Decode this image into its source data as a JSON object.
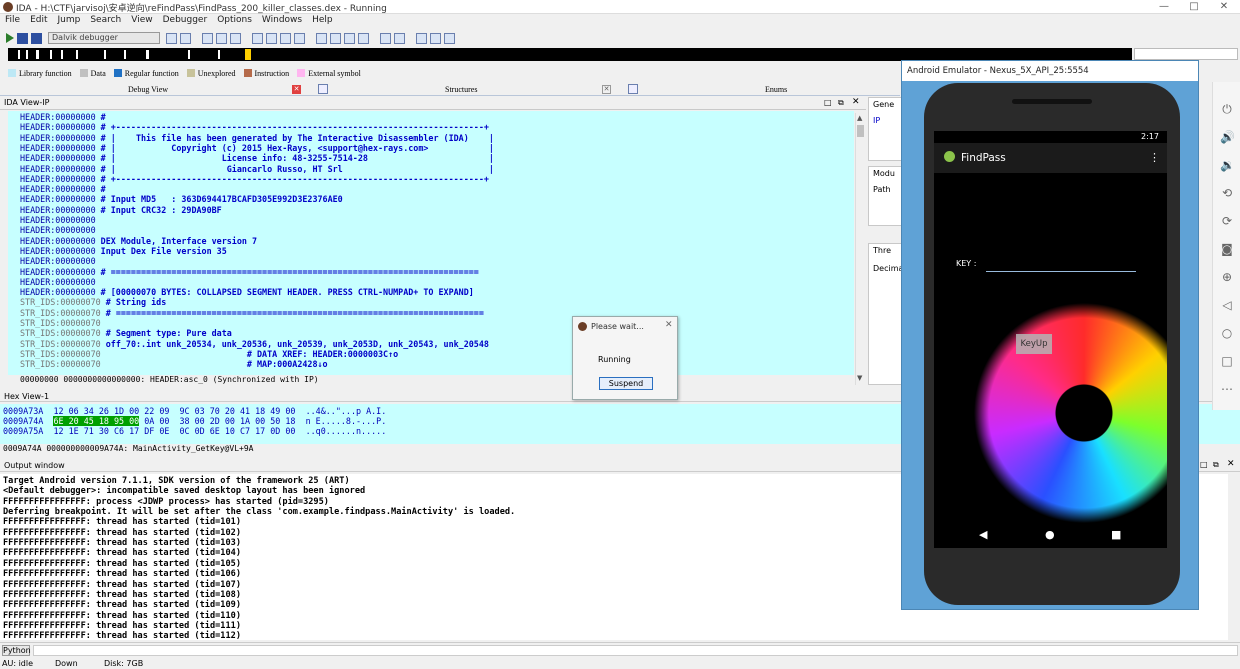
{
  "window": {
    "title": "IDA - H:\\CTF\\jarvisoj\\安卓逆向\\reFindPass\\FindPass_200_killer_classes.dex - Running",
    "controls": [
      "—",
      "□",
      "✕"
    ]
  },
  "menu": [
    "File",
    "Edit",
    "Jump",
    "Search",
    "View",
    "Debugger",
    "Options",
    "Windows",
    "Help"
  ],
  "toolbar": {
    "debugger_select": "Dalvik debugger"
  },
  "legend": [
    {
      "label": "Library function",
      "color": "#bde8f5"
    },
    {
      "label": "Data",
      "color": "#c0c0c0"
    },
    {
      "label": "Regular function",
      "color": "#2071c4"
    },
    {
      "label": "Unexplored",
      "color": "#c8c39b"
    },
    {
      "label": "Instruction",
      "color": "#b56a4a"
    },
    {
      "label": "External symbol",
      "color": "#ffb6f0"
    }
  ],
  "tabs": {
    "debug_view": "Debug View",
    "structures": "Structures",
    "enums": "Enums"
  },
  "ida_view": {
    "title": "IDA View-IP",
    "lines": [
      {
        "addr": "HEADER:00000000",
        "text": " #"
      },
      {
        "addr": "HEADER:00000000",
        "text": " # +-------------------------------------------------------------------------+"
      },
      {
        "addr": "HEADER:00000000",
        "text": " # |    This file has been generated by The Interactive Disassembler (IDA)    |"
      },
      {
        "addr": "HEADER:00000000",
        "text": " # |           Copyright (c) 2015 Hex-Rays, <support@hex-rays.com>            |"
      },
      {
        "addr": "HEADER:00000000",
        "text": " # |                     License info: 48-3255-7514-28                        |"
      },
      {
        "addr": "HEADER:00000000",
        "text": " # |                      Giancarlo Russo, HT Srl                             |"
      },
      {
        "addr": "HEADER:00000000",
        "text": " # +-------------------------------------------------------------------------+"
      },
      {
        "addr": "HEADER:00000000",
        "text": " #"
      },
      {
        "addr": "HEADER:00000000",
        "text": " # Input MD5   : 363D694417BCAFD305E992D3E2376AE0"
      },
      {
        "addr": "HEADER:00000000",
        "text": " # Input CRC32 : 29DA90BF"
      },
      {
        "addr": "HEADER:00000000",
        "text": ""
      },
      {
        "addr": "HEADER:00000000",
        "text": ""
      },
      {
        "addr": "HEADER:00000000",
        "text": " DEX Module, Interface version 7"
      },
      {
        "addr": "HEADER:00000000",
        "text": " Input Dex File version 35"
      },
      {
        "addr": "HEADER:00000000",
        "text": ""
      },
      {
        "addr": "HEADER:00000000",
        "text": " # ========================================================================="
      },
      {
        "addr": "HEADER:00000000",
        "text": ""
      },
      {
        "addr": "HEADER:00000000",
        "text": " # [00000070 BYTES: COLLAPSED SEGMENT HEADER. PRESS CTRL-NUMPAD+ TO EXPAND]"
      },
      {
        "addr": "STR_IDS:00000070",
        "text": " # String ids"
      },
      {
        "addr": "STR_IDS:00000070",
        "text": " # ========================================================================="
      },
      {
        "addr": "STR_IDS:00000070",
        "text": ""
      },
      {
        "addr": "STR_IDS:00000070",
        "text": " # Segment type: Pure data"
      },
      {
        "addr": "STR_IDS:00000070",
        "text": " off_70:.int unk_20534, unk_20536, unk_20539, unk_2053D, unk_20543, unk_20548"
      },
      {
        "addr": "STR_IDS:00000070",
        "text": "                             # DATA XREF: HEADER:0000003C↑o"
      },
      {
        "addr": "STR_IDS:00000070",
        "text": "                             # MAP:000A2428↓o"
      }
    ],
    "status": "00000000 0000000000000000: HEADER:asc_0 (Synchronized with IP)"
  },
  "hex_view": {
    "title": "Hex View-1",
    "rows": [
      {
        "addr": "0009A73A",
        "bytes": "12 06 34 26 1D 00 22 09  9C 03 70 20 41 18 49 00",
        "ascii": "..4&..\"...p A.I."
      },
      {
        "addr": "0009A74A",
        "bytes_sel": "6E 20 45 18 95 00",
        "bytes_rest": " 0A 00  38 00 2D 00 1A 00 50 18",
        "ascii": "n E.....8.-...P."
      },
      {
        "addr": "0009A75A",
        "bytes": "12 1E 71 30 C6 17 DF 0E  0C 0D 6E 10 C7 17 0D 00",
        "ascii": "..q0......n....."
      }
    ],
    "status": "0009A74A 000000000009A74A: MainActivity_GetKey@VL+9A"
  },
  "output": {
    "title": "Output window",
    "lines": [
      "Target Android version 7.1.1, SDK version of the framework 25 (ART)",
      "<Default debugger>: incompatible saved desktop layout has been ignored",
      "FFFFFFFFFFFFFFFF: process <JDWP process> has started (pid=3295)",
      "Deferring breakpoint. It will be set after the class 'com.example.findpass.MainActivity' is loaded.",
      "FFFFFFFFFFFFFFFF: thread has started (tid=101)",
      "FFFFFFFFFFFFFFFF: thread has started (tid=102)",
      "FFFFFFFFFFFFFFFF: thread has started (tid=103)",
      "FFFFFFFFFFFFFFFF: thread has started (tid=104)",
      "FFFFFFFFFFFFFFFF: thread has started (tid=105)",
      "FFFFFFFFFFFFFFFF: thread has started (tid=106)",
      "FFFFFFFFFFFFFFFF: thread has started (tid=107)",
      "FFFFFFFFFFFFFFFF: thread has started (tid=108)",
      "FFFFFFFFFFFFFFFF: thread has started (tid=109)",
      "FFFFFFFFFFFFFFFF: thread has started (tid=110)",
      "FFFFFFFFFFFFFFFF: thread has started (tid=111)",
      "FFFFFFFFFFFFFFFF: thread has started (tid=112)"
    ]
  },
  "python_btn": "Python",
  "statusbar": {
    "au": "AU:  idle",
    "dir": "Down",
    "disk": "Disk: 7GB"
  },
  "side_panels": {
    "general": "Gene",
    "ip": "IP",
    "modules": "Modu",
    "path": "Path",
    "threads": "Thre",
    "decimal": "Decimal"
  },
  "dialog": {
    "title": "Please wait...",
    "message": "Running",
    "button": "Suspend"
  },
  "emulator": {
    "title": "Android Emulator - Nexus_5X_API_25:5554",
    "clock": "2:17",
    "app_title": "FindPass",
    "key_label": "KEY :",
    "button": "KeyUp"
  }
}
